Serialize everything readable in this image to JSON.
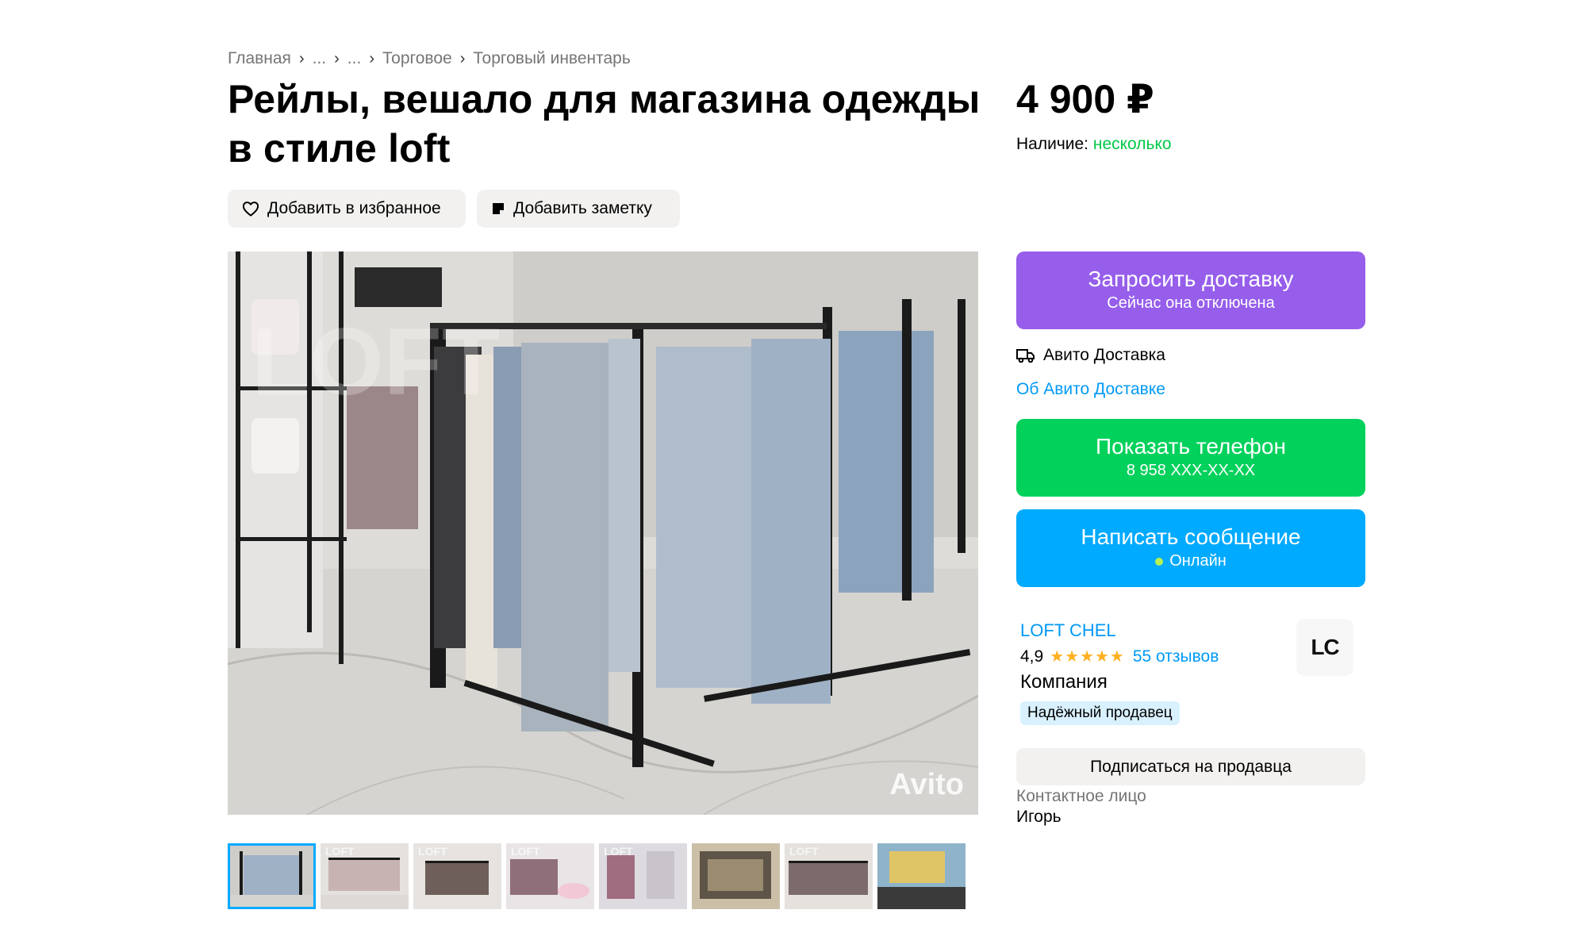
{
  "breadcrumb": {
    "items": [
      "Главная",
      "...",
      "...",
      "Торговое",
      "Торговый инвентарь"
    ],
    "separator": "›"
  },
  "listing": {
    "title": "Рейлы, вешало для магазина одежды в стиле loft",
    "price": "4 900 ₽",
    "availability_label": "Наличие: ",
    "availability_value": "несколько"
  },
  "actions": {
    "favorite_label": "Добавить в избранное",
    "note_label": "Добавить заметку"
  },
  "gallery": {
    "watermark": "Avito",
    "thumb_watermark": "LOFT",
    "thumbnail_count": 8,
    "active_index": 0
  },
  "delivery": {
    "request_title": "Запросить доставку",
    "request_subtitle": "Сейчас она отключена",
    "service_label": "Авито Доставка",
    "about_link": "Об Авито Доставке"
  },
  "contact": {
    "phone_title": "Показать телефон",
    "phone_masked": "8 958 XXX-XX-XX",
    "message_title": "Написать сообщение",
    "message_status": "Онлайн",
    "subscribe_label": "Подписаться на продавца",
    "person_label": "Контактное лицо",
    "person_name": "Игорь"
  },
  "seller": {
    "name": "LOFT CHEL",
    "rating": "4,9",
    "stars": "★★★★★",
    "reviews": "55 отзывов",
    "type": "Компания",
    "badge": "Надёжный продавец",
    "logo_text": "LC"
  },
  "colors": {
    "delivery_button": "#965eeb",
    "phone_button": "#02d15c",
    "message_button": "#00aaff",
    "link": "#0099f7",
    "availability": "#02c848",
    "chip_bg": "#f2f1f0"
  }
}
